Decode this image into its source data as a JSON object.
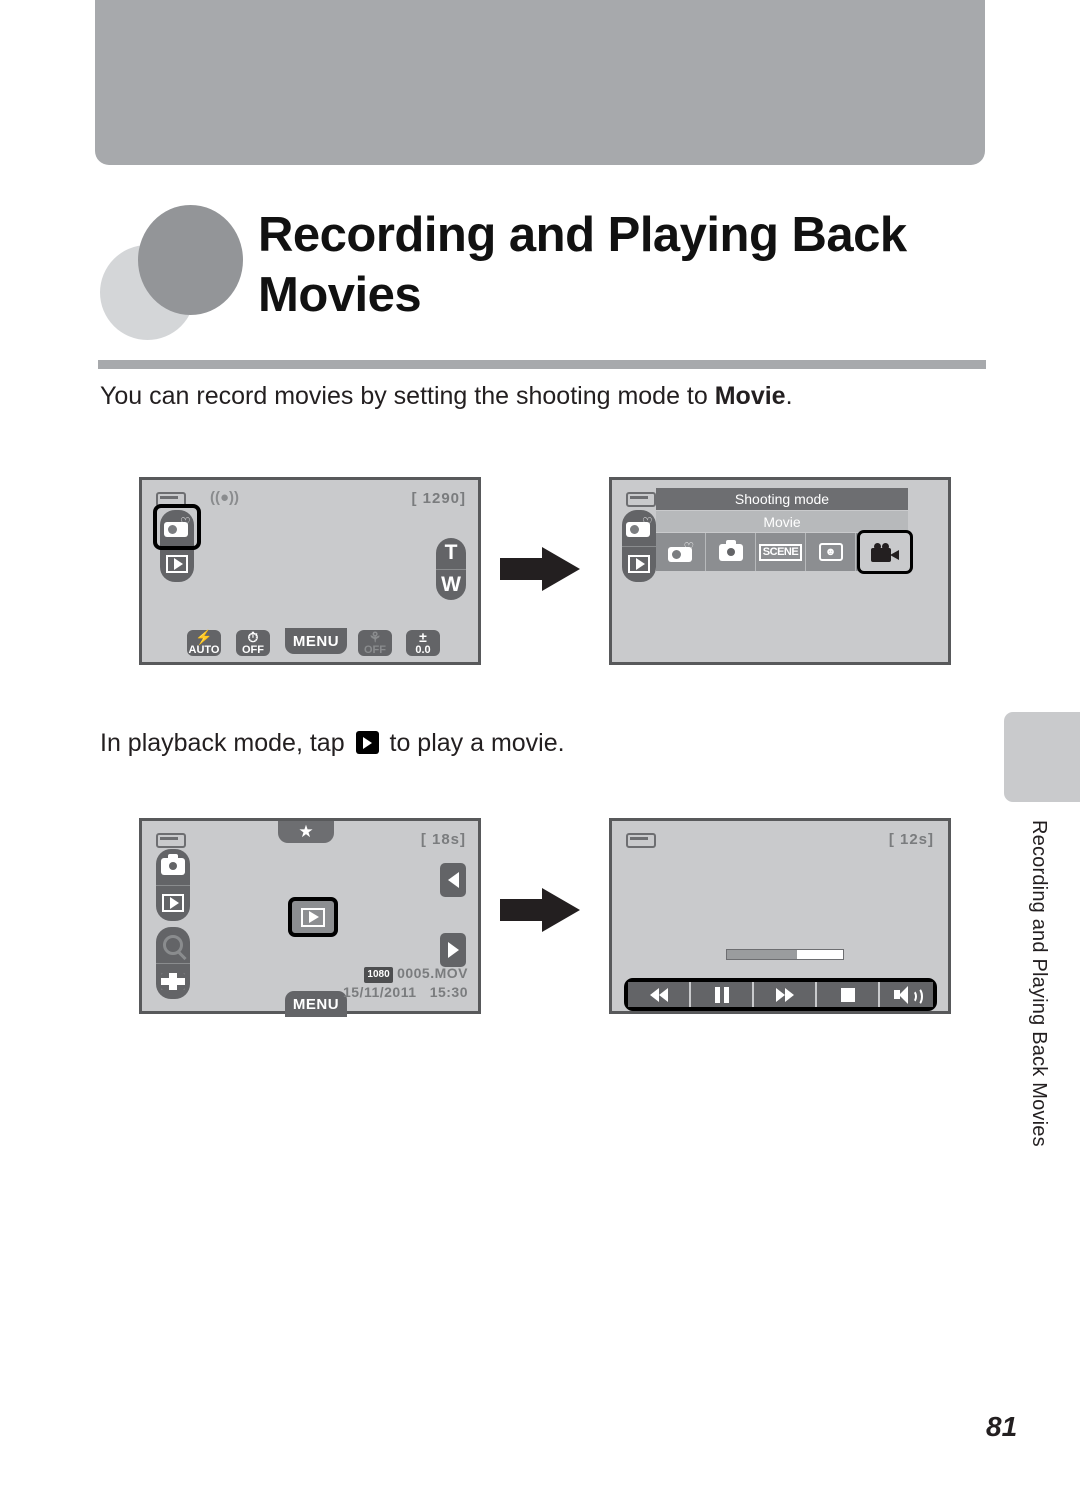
{
  "document": {
    "page_number": "81",
    "running_head": "Recording and Playing Back Movies",
    "title": "Recording and Playing Back Movies",
    "intro_text_before": "You can record movies by setting the shooting mode to ",
    "intro_text_bold": "Movie",
    "intro_text_after": ".",
    "playback_text_before": "In playback mode, tap ",
    "playback_text_after": " to play a movie."
  },
  "screens": {
    "shooting": {
      "counter": "[ 1290]",
      "vr_icon": "((●))",
      "left_buttons": [
        {
          "name": "auto-scene-mode",
          "selected": true
        },
        {
          "name": "playback-mode",
          "selected": false
        }
      ],
      "zoom": {
        "tele": "T",
        "wide": "W"
      },
      "toolbar": [
        {
          "name": "flash-mode",
          "glyph": "⚡",
          "label": "AUTO",
          "dim": false
        },
        {
          "name": "self-timer",
          "glyph": "⏱",
          "label": "OFF",
          "dim": false
        },
        {
          "name": "menu",
          "label": "MENU"
        },
        {
          "name": "macro-mode",
          "glyph": "⚘",
          "label": "OFF",
          "dim": true
        },
        {
          "name": "exposure-compensation",
          "glyph": "±",
          "label": "0.0",
          "dim": false
        }
      ]
    },
    "shooting_mode_menu": {
      "header": "Shooting mode",
      "subheader": "Movie",
      "options": [
        {
          "name": "auto-scene-selector",
          "selected": false
        },
        {
          "name": "auto-mode",
          "selected": false
        },
        {
          "name": "scene-mode",
          "label": "SCENE",
          "selected": false
        },
        {
          "name": "smart-portrait",
          "selected": false
        },
        {
          "name": "movie-mode",
          "selected": true
        }
      ]
    },
    "playback": {
      "duration": "[      18s]",
      "favorite_icon": "★",
      "left_buttons": [
        {
          "name": "shooting-mode",
          "dim": false
        },
        {
          "name": "playback-mode",
          "dim": false
        },
        {
          "name": "zoom-in",
          "dim": true
        },
        {
          "name": "thumbnail-view",
          "dim": false
        }
      ],
      "menu_label": "MENU",
      "file_badge": "1080",
      "file_name": "0005.MOV",
      "date": "15/11/2011",
      "time": "15:30"
    },
    "movie_playback": {
      "duration": "[      12s]",
      "progress_percent": 60,
      "controls": [
        {
          "name": "rewind-button"
        },
        {
          "name": "pause-button"
        },
        {
          "name": "fast-forward-button"
        },
        {
          "name": "stop-button"
        },
        {
          "name": "volume-button"
        }
      ]
    }
  },
  "colors": {
    "band_grey": "#a7a9ac",
    "screen_bg": "#c9cacc",
    "button_grey": "#636467",
    "selection_black": "#000000"
  }
}
